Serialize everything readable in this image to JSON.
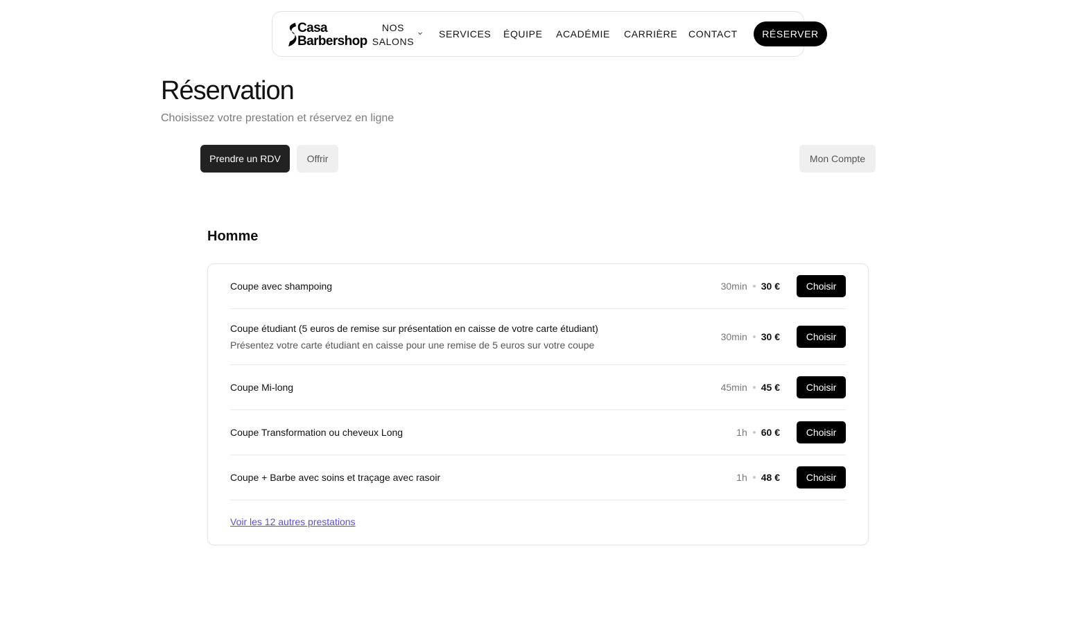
{
  "nav": {
    "logo_line1": "Casa",
    "logo_line2": "Barbershop",
    "salons_line1": "NOS",
    "salons_line2": "SALONS",
    "links": [
      "SERVICES",
      "ÉQUIPE",
      "ACADÉMIE",
      "CARRIÈRE",
      "CONTACT"
    ],
    "cta": "RÉSERVER"
  },
  "header": {
    "title": "Réservation",
    "subtitle": "Choisissez votre prestation et réservez en ligne"
  },
  "tabs": {
    "book": "Prendre un RDV",
    "gift": "Offrir",
    "account": "Mon Compte"
  },
  "section": {
    "title": "Homme",
    "services": [
      {
        "name": "Coupe avec shampoing",
        "description": "",
        "duration": "30min",
        "price": "30 €",
        "button": "Choisir"
      },
      {
        "name": "Coupe étudiant (5 euros de remise sur présentation en caisse de votre carte étudiant)",
        "description": "Présentez votre carte étudiant en caisse pour une remise de 5 euros sur votre coupe",
        "duration": "30min",
        "price": "30 €",
        "button": "Choisir"
      },
      {
        "name": "Coupe Mi-long",
        "description": "",
        "duration": "45min",
        "price": "45 €",
        "button": "Choisir"
      },
      {
        "name": "Coupe Transformation ou cheveux Long",
        "description": "",
        "duration": "1h",
        "price": "60 €",
        "button": "Choisir"
      },
      {
        "name": "Coupe + Barbe avec soins et traçage avec rasoir",
        "description": "",
        "duration": "1h",
        "price": "48 €",
        "button": "Choisir"
      }
    ],
    "more_link": "Voir les 12 autres prestations"
  },
  "colors": {
    "primary": "#000000",
    "tab_active": "#222222",
    "tab_inactive": "#efefef",
    "link": "#5b4fd6"
  }
}
